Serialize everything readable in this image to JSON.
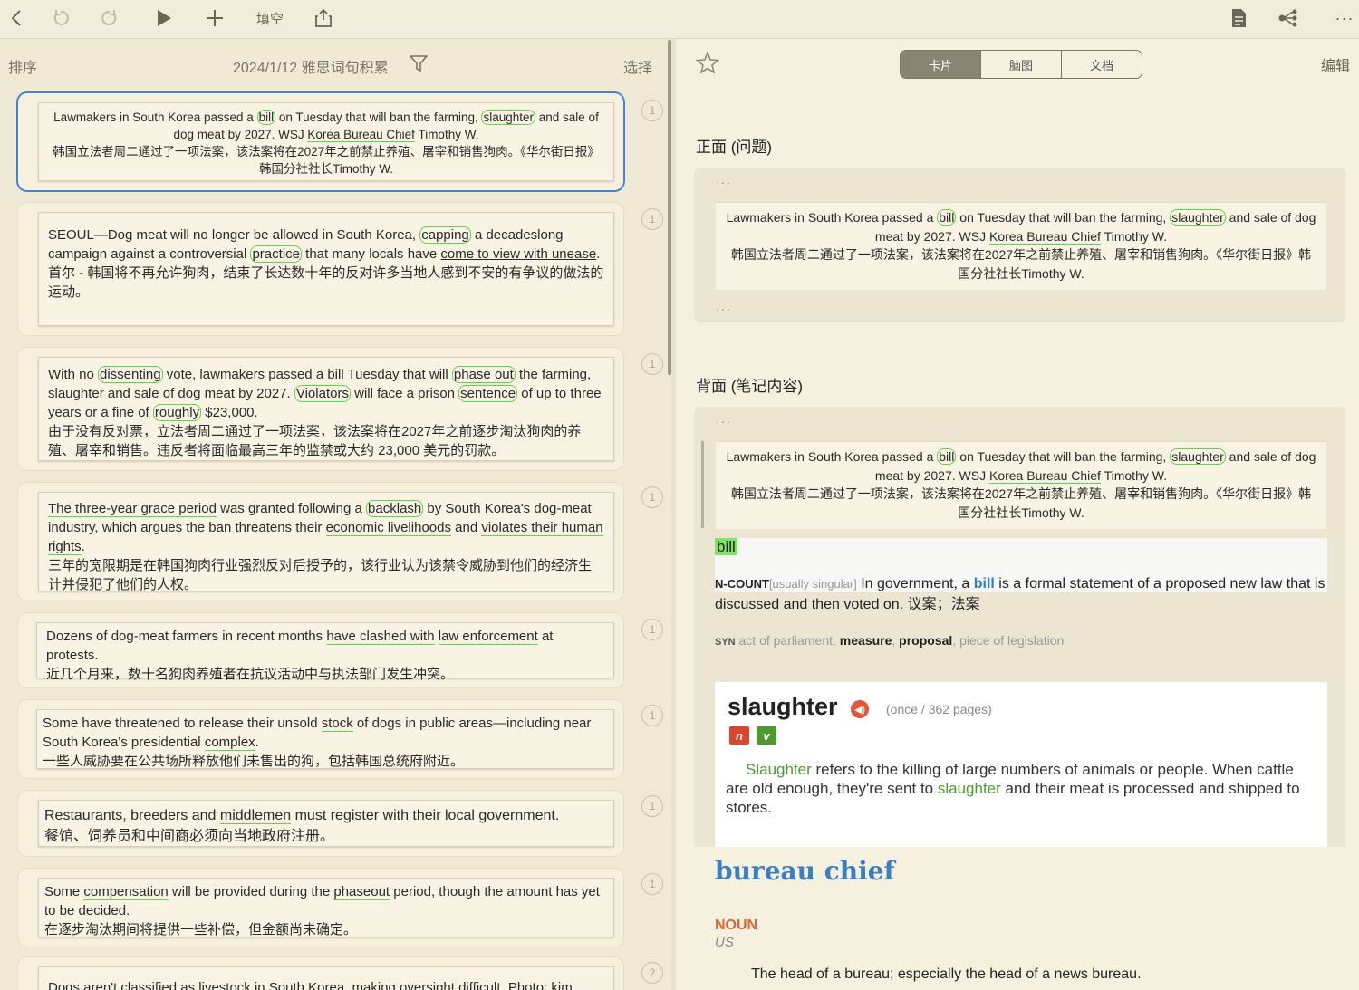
{
  "toolbar": {
    "fill_label": "填空"
  },
  "list": {
    "sort_label": "排序",
    "title": "2024/1/12 雅思词句积累",
    "select_label": "选择",
    "cards": [
      {
        "badge": "1",
        "en_parts": [
          "Lawmakers in South Korea passed a ",
          "bill",
          " on Tuesday that will ban the farming, ",
          "slaughter",
          " and sale of dog meat by 2027. WSJ ",
          "Korea Bureau Chief",
          " Timothy W."
        ],
        "zh": "韩国立法者周二通过了一项法案，该法案将在2027年之前禁止养殖、屠宰和销售狗肉。《华尔街日报》韩国分社社长Timothy W."
      },
      {
        "badge": "1",
        "en_parts": [
          "SEOUL—Dog meat will no longer be allowed in South Korea, ",
          "capping",
          " a decadeslong campaign against a controversial ",
          "practice",
          " that many locals have ",
          "come to view with unease",
          "."
        ],
        "zh": "首尔 - 韩国将不再允许狗肉，结束了长达数十年的反对许多当地人感到不安的有争议的做法的运动。"
      },
      {
        "badge": "1",
        "en_parts": [
          "With no ",
          "dissenting",
          " vote, lawmakers passed a bill Tuesday that will ",
          "phase out",
          " the farming, slaughter and sale of dog meat by 2027. ",
          "Violators",
          " will face a prison ",
          "sentence",
          " of up to three years or a fine of ",
          "roughly",
          " $23,000."
        ],
        "zh": "由于没有反对票，立法者周二通过了一项法案，该法案将在2027年之前逐步淘汰狗肉的养殖、屠宰和销售。违反者将面临最高三年的监禁或大约 23,000 美元的罚款。"
      },
      {
        "badge": "1",
        "en_parts": [
          "The three-year grace period",
          " was granted following a ",
          "backlash",
          " by South Korea's dog-meat industry, which argues the ban threatens their ",
          "economic livelihoods",
          " and ",
          "violates their human rights",
          "."
        ],
        "zh": "三年的宽限期是在韩国狗肉行业强烈反对后授予的，该行业认为该禁令威胁到他们的经济生计并侵犯了他们的人权。"
      },
      {
        "badge": "1",
        "en_parts": [
          "Dozens of dog-meat farmers in recent months ",
          "have clashed with",
          " ",
          "law enforcement",
          " at protests."
        ],
        "zh": "近几个月来，数十名狗肉养殖者在抗议活动中与执法部门发生冲突。"
      },
      {
        "badge": "1",
        "en_parts": [
          "Some have threatened to release their unsold ",
          "stock",
          " of dogs in public areas—including near South Korea's presidential ",
          "complex",
          "."
        ],
        "zh": "一些人威胁要在公共场所释放他们未售出的狗，包括韩国总统府附近。"
      },
      {
        "badge": "1",
        "en_parts": [
          "Restaurants, breeders and ",
          "middlemen",
          " must register with their local government."
        ],
        "zh": "餐馆、饲养员和中间商必须向当地政府注册。"
      },
      {
        "badge": "1",
        "en_parts": [
          "Some ",
          "compensation",
          " will be provided during the ",
          "phaseout",
          " period, though the amount has yet to be decided."
        ],
        "zh": "在逐步淘汰期间将提供一些补偿，但金额尚未确定。"
      },
      {
        "badge": "2",
        "en_parts": [
          "Dogs aren't classified as livestock in South Korea, making oversight difficult. Photo: kim"
        ],
        "zh": ""
      }
    ]
  },
  "detail": {
    "tabs": [
      "卡片",
      "脑图",
      "文档"
    ],
    "edit_label": "编辑",
    "front_title": "正面 (问题)",
    "back_title": "背面 (笔记内容)",
    "dots": "···",
    "bill": {
      "word": "bill",
      "pos": "N-COUNT",
      "note": "[usually singular]",
      "def_a": " In government, a ",
      "def_word": "bill",
      "def_b": " is a formal statement of a proposed new law that is discussed and then voted on. 议案；法案",
      "syn_label": "SYN",
      "syn_a": " act of parliament, ",
      "syn_b": "measure",
      "syn_c": ", ",
      "syn_d": "proposal",
      "syn_e": ", piece of legislation"
    },
    "slaughter": {
      "word": "slaughter",
      "meta": "(once / 362 pages)",
      "tag_n": "n",
      "tag_v": "v",
      "w1": "Slaughter",
      "t1": " refers to the killing of large numbers of animals or people. When cattle are old enough, they're sent to ",
      "w2": "slaughter",
      "t2": " and their meat is processed and shipped to stores."
    },
    "bureau": {
      "word": "bureau chief",
      "pos": "NOUN",
      "region": "US",
      "def": "The head of a bureau; especially the head of a news bureau."
    }
  }
}
